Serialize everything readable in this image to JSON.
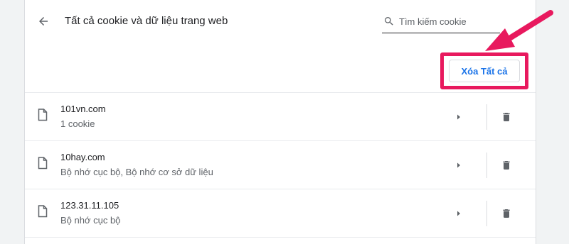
{
  "header": {
    "title": "Tất cả cookie và dữ liệu trang web",
    "back_icon": "arrow-back-icon"
  },
  "search": {
    "placeholder": "Tìm kiếm cookie",
    "value": "",
    "icon": "search-icon"
  },
  "toolbar": {
    "remove_all_label": "Xóa Tất cả"
  },
  "sites": [
    {
      "name": "101vn.com",
      "detail": "1 cookie"
    },
    {
      "name": "10hay.com",
      "detail": "Bộ nhớ cục bộ, Bộ nhớ cơ sở dữ liệu"
    },
    {
      "name": "123.31.11.105",
      "detail": "Bộ nhớ cục bộ"
    }
  ],
  "colors": {
    "accent": "#1a73e8",
    "highlight": "#e8195e",
    "text_primary": "#202124",
    "text_secondary": "#5f6368",
    "icon": "#5f6368",
    "divider": "#dadce0",
    "page_bg": "#f1f3f4"
  },
  "icons": {
    "row_file": "file-icon",
    "row_expand": "chevron-right-icon",
    "row_delete": "trash-icon"
  }
}
